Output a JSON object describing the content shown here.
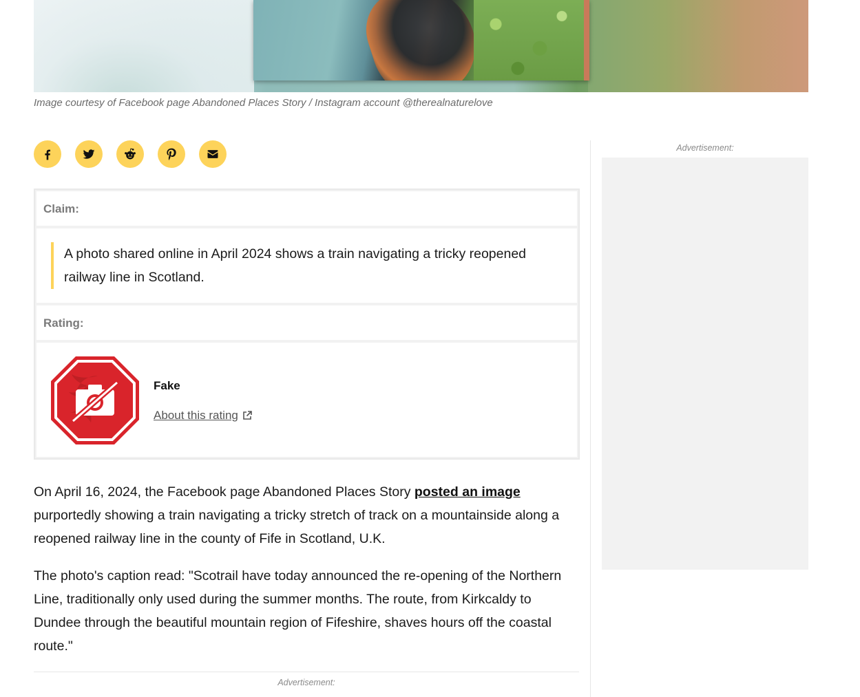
{
  "hero": {
    "caption": "Image courtesy of Facebook page Abandoned Places Story / Instagram account @therealnaturelove"
  },
  "share": {
    "buttons": [
      {
        "name": "facebook",
        "icon": "facebook-icon"
      },
      {
        "name": "twitter",
        "icon": "twitter-icon"
      },
      {
        "name": "reddit",
        "icon": "reddit-icon"
      },
      {
        "name": "pinterest",
        "icon": "pinterest-icon"
      },
      {
        "name": "email",
        "icon": "envelope-icon"
      }
    ],
    "button_color": "#fdd35a"
  },
  "fact_check": {
    "claim_label": "Claim:",
    "claim_text": "A photo shared online in April 2024 shows a train navigating a tricky reopened railway line in Scotland.",
    "rating_label": "Rating:",
    "rating_value": "Fake",
    "rating_link_text": "About this rating",
    "rating_icon": "fake-stop-sign-icon",
    "rating_color": "#d9242b",
    "accent_color": "#fdd35a"
  },
  "article": {
    "p1_before": "On April 16, 2024, the Facebook page Abandoned Places Story ",
    "p1_link": "posted an image",
    "p1_after": " purportedly showing a train navigating a tricky stretch of track on a mountainside along a reopened railway line in the county of Fife in Scotland, U.K.",
    "p2": "The photo's caption read: \"Scotrail have today announced the re-opening of the Northern Line, traditionally only used during the summer months. The route, from Kirkcaldy to Dundee through the beautiful mountain region of Fifeshire, shaves hours off the coastal route.\""
  },
  "ads": {
    "sidebar_label": "Advertisement:",
    "inline_label": "Advertisement:"
  }
}
